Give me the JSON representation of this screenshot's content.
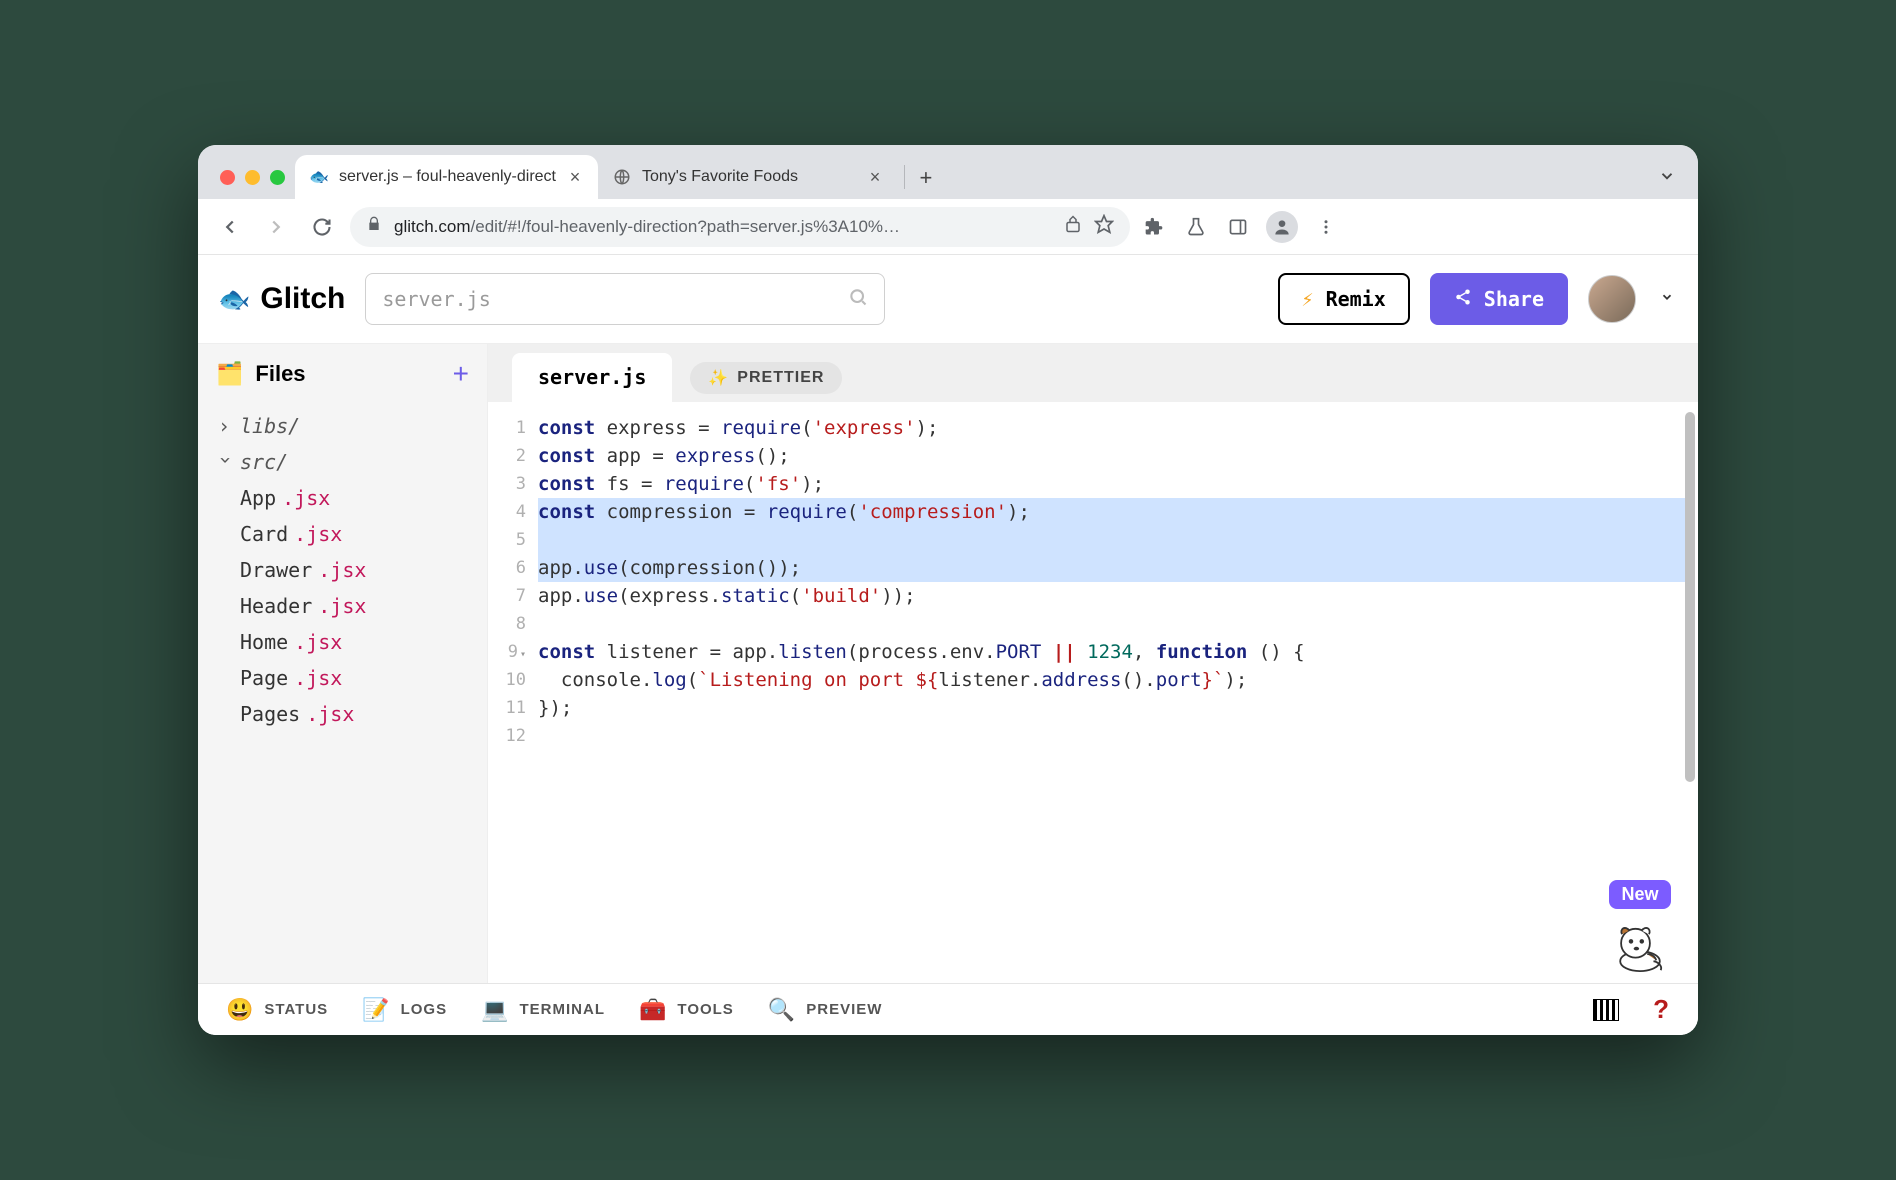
{
  "browser": {
    "tabs": [
      {
        "title": "server.js – foul-heavenly-direct",
        "favicon": "🐟",
        "active": true
      },
      {
        "title": "Tony's Favorite Foods",
        "favicon": "◉",
        "active": false
      }
    ],
    "url_domain": "glitch.com",
    "url_path": "/edit/#!/foul-heavenly-direction?path=server.js%3A10%…"
  },
  "header": {
    "logo_text": "Glitch",
    "search_placeholder": "server.js",
    "remix_label": "Remix",
    "share_label": "Share"
  },
  "sidebar": {
    "header": "Files",
    "tree": {
      "folders": [
        {
          "name": "libs/",
          "expanded": false
        },
        {
          "name": "src/",
          "expanded": true,
          "files": [
            "App.jsx",
            "Card.jsx",
            "Drawer.jsx",
            "Header.jsx",
            "Home.jsx",
            "Page.jsx",
            "Pages.jsx"
          ]
        }
      ]
    }
  },
  "editor": {
    "active_tab": "server.js",
    "prettier_label": "PRETTIER",
    "lines": [
      {
        "n": 1,
        "hl": false,
        "tokens": [
          [
            "kw",
            "const"
          ],
          [
            "",
            " express = "
          ],
          [
            "fn",
            "require"
          ],
          [
            "",
            "("
          ],
          [
            "str",
            "'express'"
          ],
          [
            "",
            ");"
          ]
        ]
      },
      {
        "n": 2,
        "hl": false,
        "tokens": [
          [
            "kw",
            "const"
          ],
          [
            "",
            " app = "
          ],
          [
            "fn",
            "express"
          ],
          [
            "",
            "();"
          ]
        ]
      },
      {
        "n": 3,
        "hl": false,
        "tokens": [
          [
            "kw",
            "const"
          ],
          [
            "",
            " fs = "
          ],
          [
            "fn",
            "require"
          ],
          [
            "",
            "("
          ],
          [
            "str",
            "'fs'"
          ],
          [
            "",
            ");"
          ]
        ]
      },
      {
        "n": 4,
        "hl": true,
        "tokens": [
          [
            "kw",
            "const"
          ],
          [
            "",
            " compression = "
          ],
          [
            "fn",
            "require"
          ],
          [
            "",
            "("
          ],
          [
            "str",
            "'compression'"
          ],
          [
            "",
            ");"
          ]
        ]
      },
      {
        "n": 5,
        "hl": true,
        "tokens": [
          [
            "",
            ""
          ]
        ]
      },
      {
        "n": 6,
        "hl": true,
        "tokens": [
          [
            "",
            "app."
          ],
          [
            "prop",
            "use"
          ],
          [
            "",
            "(compression());"
          ]
        ]
      },
      {
        "n": 7,
        "hl": false,
        "tokens": [
          [
            "",
            "app."
          ],
          [
            "prop",
            "use"
          ],
          [
            "",
            "(express."
          ],
          [
            "prop",
            "static"
          ],
          [
            "",
            "("
          ],
          [
            "str",
            "'build'"
          ],
          [
            "",
            "));"
          ]
        ]
      },
      {
        "n": 8,
        "hl": false,
        "tokens": [
          [
            "",
            ""
          ]
        ]
      },
      {
        "n": 9,
        "hl": false,
        "fold": true,
        "tokens": [
          [
            "kw",
            "const"
          ],
          [
            "",
            " listener = app."
          ],
          [
            "prop",
            "listen"
          ],
          [
            "",
            "(process.env."
          ],
          [
            "prop",
            "PORT"
          ],
          [
            "",
            " "
          ],
          [
            "op",
            "||"
          ],
          [
            "",
            " "
          ],
          [
            "num",
            "1234"
          ],
          [
            "",
            ", "
          ],
          [
            "kw",
            "function"
          ],
          [
            "",
            " () {"
          ]
        ]
      },
      {
        "n": 10,
        "hl": false,
        "tokens": [
          [
            "",
            "  console."
          ],
          [
            "prop",
            "log"
          ],
          [
            "",
            "("
          ],
          [
            "str",
            "`Listening on port ${"
          ],
          [
            "",
            "listener."
          ],
          [
            "prop",
            "address"
          ],
          [
            "",
            "()."
          ],
          [
            "prop",
            "port"
          ],
          [
            "str",
            "}`"
          ],
          [
            "",
            ");"
          ]
        ]
      },
      {
        "n": 11,
        "hl": false,
        "tokens": [
          [
            "",
            "});"
          ]
        ]
      },
      {
        "n": 12,
        "hl": false,
        "tokens": [
          [
            "",
            ""
          ]
        ]
      }
    ],
    "new_badge": "New"
  },
  "bottombar": {
    "items": [
      "STATUS",
      "LOGS",
      "TERMINAL",
      "TOOLS",
      "PREVIEW"
    ],
    "icons": [
      "😃",
      "📝",
      "💻",
      "🧰",
      "🔍"
    ]
  }
}
